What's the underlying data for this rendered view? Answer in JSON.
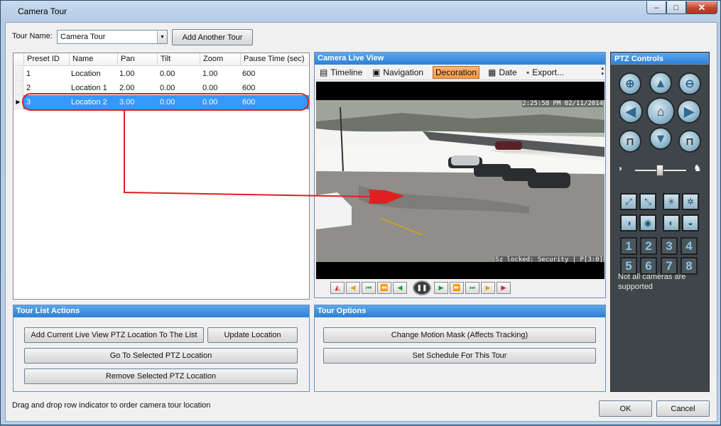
{
  "window": {
    "title": "Camera Tour",
    "minimize": "–",
    "maximize": "□",
    "close": "✕"
  },
  "tour": {
    "name_label": "Tour Name:",
    "name_value": "Camera Tour",
    "add_button": "Add Another Tour"
  },
  "presets": {
    "columns": [
      "Preset ID",
      "Name",
      "Pan",
      "Tilt",
      "Zoom",
      "Pause Time (sec)"
    ],
    "rows": [
      {
        "id": "1",
        "name": "Location",
        "pan": "1.00",
        "tilt": "0.00",
        "zoom": "1.00",
        "pause": "600"
      },
      {
        "id": "2",
        "name": "Location 1",
        "pan": "2.00",
        "tilt": "0.00",
        "zoom": "0.00",
        "pause": "600"
      },
      {
        "id": "3",
        "name": "Location 2",
        "pan": "3.00",
        "tilt": "0.00",
        "zoom": "0.00",
        "pause": "600"
      }
    ]
  },
  "live_view": {
    "title": "Camera Live View",
    "toolbar": [
      "Timeline",
      "Navigation",
      "Decoration",
      "Date",
      "Export..."
    ],
    "active_tool": "Decoration",
    "timestamp": "2:25:58 PM 02/11/2014",
    "caption": "Sz locked: Security | P[3:0]"
  },
  "ptz": {
    "title": "PTZ Controls",
    "presets": [
      "1",
      "2",
      "3",
      "4",
      "5",
      "6",
      "7",
      "8"
    ],
    "note": "Not all cameras are supported"
  },
  "tour_list_actions": {
    "title": "Tour List Actions",
    "add_current": "Add Current Live View PTZ Location To The List",
    "update": "Update Location",
    "goto": "Go To Selected PTZ Location",
    "remove": "Remove Selected PTZ Location"
  },
  "tour_options": {
    "title": "Tour Options",
    "motion_mask": "Change Motion Mask (Affects Tracking)",
    "schedule": "Set Schedule For This Tour"
  },
  "footer": {
    "hint": "Drag and drop row indicator to order camera tour location",
    "ok": "OK",
    "cancel": "Cancel"
  },
  "colors": {
    "accent": "#2c7fd6",
    "selection": "#3399ff",
    "annotation": "#e02020",
    "active_tool": "#f29a4c"
  }
}
